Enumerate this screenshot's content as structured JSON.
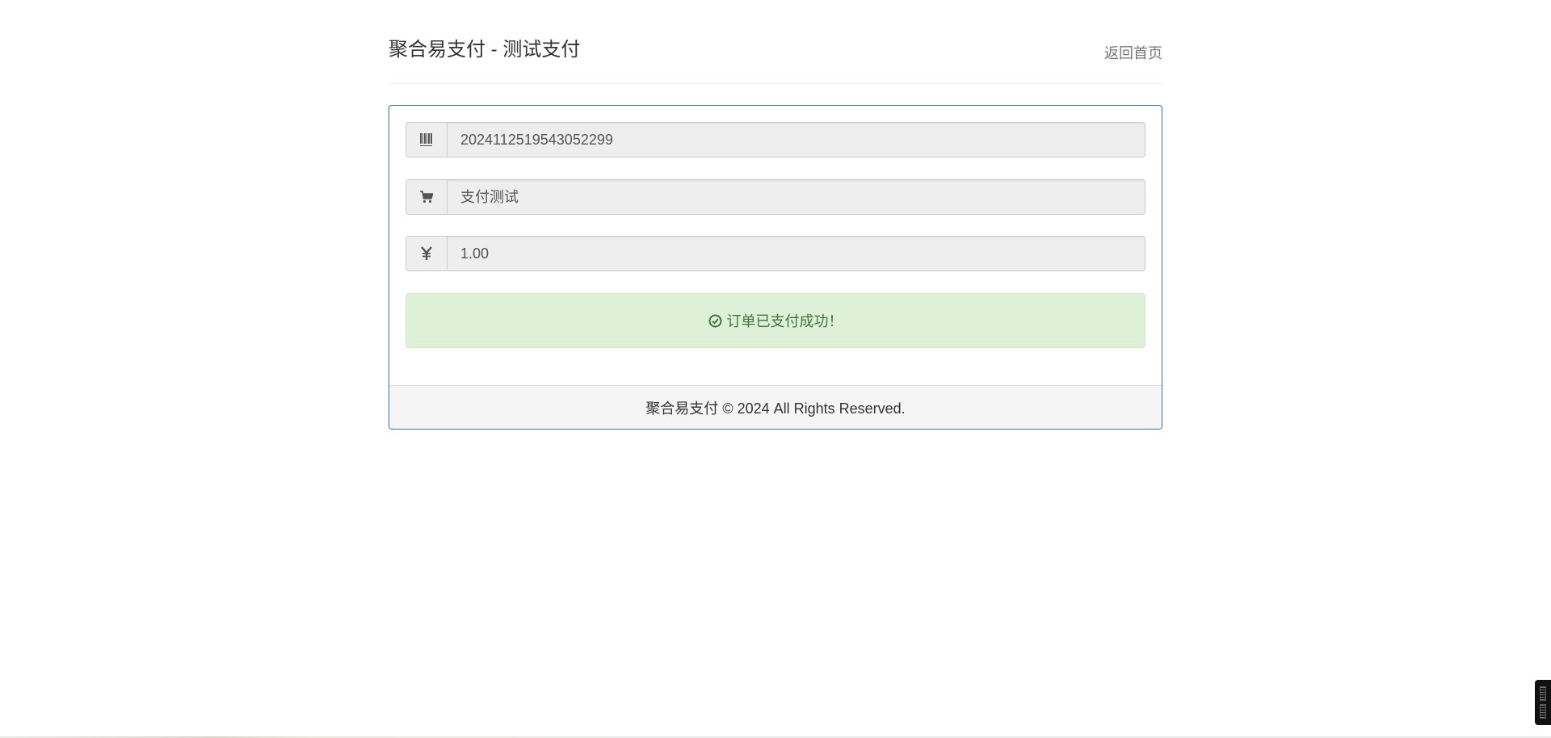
{
  "header": {
    "title": "聚合易支付 - 测试支付",
    "home_link": "返回首页"
  },
  "form": {
    "order_no": {
      "icon": "barcode-icon",
      "value": "2024112519543052299"
    },
    "product_name": {
      "icon": "shopping-cart-icon",
      "value": "支付测试"
    },
    "amount": {
      "icon": "yen-icon",
      "value": "1.00"
    }
  },
  "status": {
    "icon": "check-circle-icon",
    "message": "订单已支付成功！"
  },
  "footer": {
    "text": "聚合易支付 © 2024 All Rights Reserved."
  },
  "colors": {
    "panel_border": "#337ab7",
    "success_bg": "#dff0d8",
    "success_text": "#3c763d"
  }
}
